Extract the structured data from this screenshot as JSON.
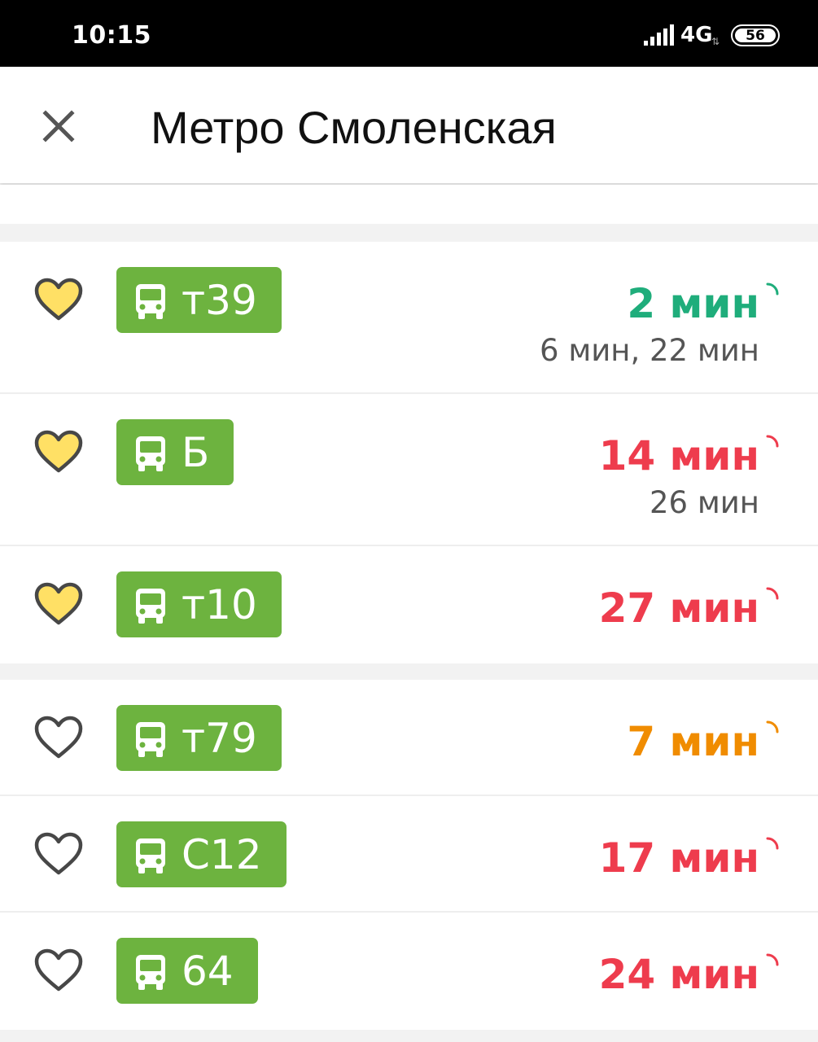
{
  "status_bar": {
    "time": "10:15",
    "network": "4G",
    "battery": "56"
  },
  "header": {
    "title": "Метро Смоленская"
  },
  "favorite_routes": [
    {
      "number": "т39",
      "eta": "2 мин",
      "eta_color": "#1fad7b",
      "next": "6 мин, 22 мин",
      "favorite": true,
      "icon": "trolleybus-icon"
    },
    {
      "number": "Б",
      "eta": "14 мин",
      "eta_color": "#ee3c4d",
      "next": "26 мин",
      "favorite": true,
      "icon": "trolleybus-icon"
    },
    {
      "number": "т10",
      "eta": "27 мин",
      "eta_color": "#ee3c4d",
      "next": "",
      "favorite": true,
      "icon": "trolleybus-icon"
    }
  ],
  "other_routes": [
    {
      "number": "т79",
      "eta": "7 мин",
      "eta_color": "#f08c00",
      "next": "",
      "favorite": false,
      "icon": "trolleybus-icon"
    },
    {
      "number": "С12",
      "eta": "17 мин",
      "eta_color": "#ee3c4d",
      "next": "",
      "favorite": false,
      "icon": "bus-icon"
    },
    {
      "number": "64",
      "eta": "24 мин",
      "eta_color": "#ee3c4d",
      "next": "",
      "favorite": false,
      "icon": "bus-icon"
    }
  ],
  "colors": {
    "badge": "#6db33f",
    "heart_fill": "#ffe065",
    "heart_stroke": "#474747"
  }
}
